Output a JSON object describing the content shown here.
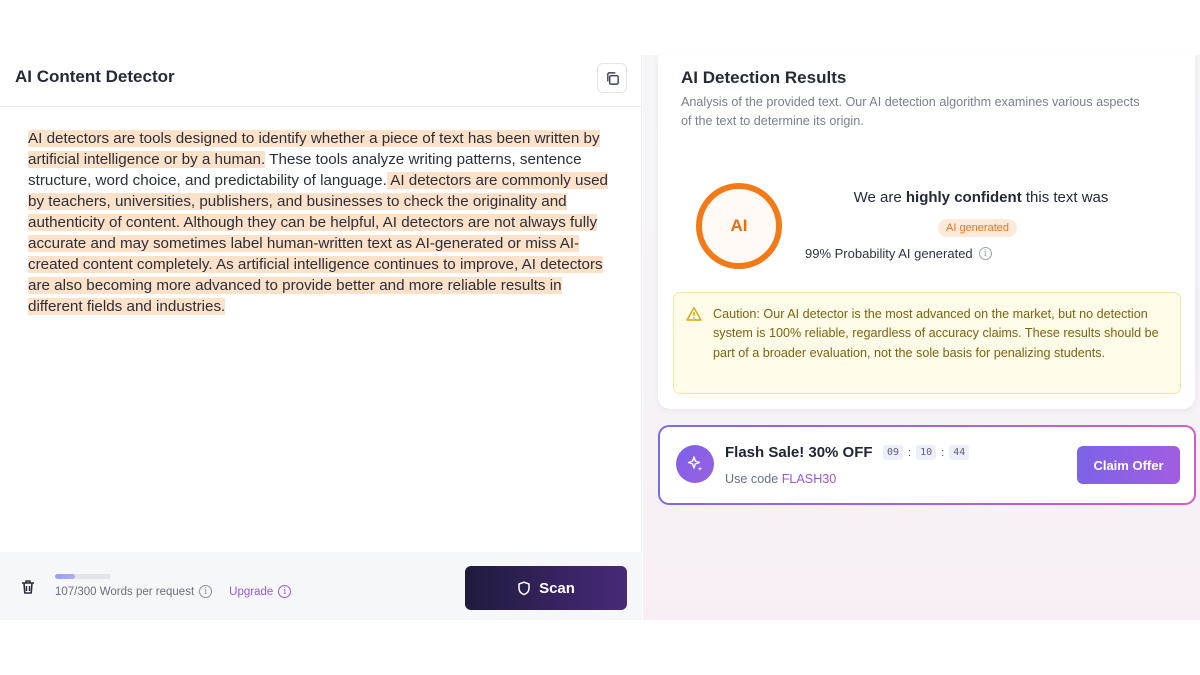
{
  "editor": {
    "title": "AI Content Detector",
    "paragraph_segments": [
      "AI detectors are tools designed to identify whether a piece of text has been written by artificial intelligence or by a human.",
      " These tools analyze writing patterns, sentence structure, word choice, and predictability of language.",
      " AI detectors are commonly used by teachers, universities, publishers, and businesses to check the originality and authenticity of content.",
      " Although they can be helpful, AI detectors are not always fully accurate and may sometimes label human-written text as AI-generated or miss AI-created content completely.",
      " As artificial intelligence continues to improve, AI detectors are also becoming more advanced to provide better and more reliable results in different fields and industries."
    ],
    "word_count_text": "107/300 Words per request",
    "word_usage_fraction": 0.357,
    "upgrade_label": "Upgrade",
    "scan_label": "Scan",
    "icons": {
      "copy": "copy-icon",
      "trash": "trash-icon",
      "shield": "shield-icon",
      "info": "info-icon"
    }
  },
  "results": {
    "title": "AI Detection Results",
    "subtitle": "Analysis of the provided text. Our AI detection algorithm examines various aspects of the text to determine its origin.",
    "ring_label": "AI",
    "confidence_prefix": "We are ",
    "confidence_strong": "highly confident",
    "confidence_suffix": " this text was",
    "verdict_badge": "AI generated",
    "probability_text": "99% Probability AI generated",
    "caution_text": "Caution: Our AI detector is the most advanced on the market, but no detection system is 100% reliable, regardless of accuracy claims. These results should be part of a broader evaluation, not the sole basis for penalizing students.",
    "colors": {
      "ring": "#f47a17",
      "badge_bg": "#fde9da",
      "caution_bg": "#fefbe8"
    }
  },
  "promo": {
    "title": "Flash Sale! 30% OFF",
    "timer": [
      "09",
      "10",
      "44"
    ],
    "code_prefix": "Use code ",
    "code": "FLASH30",
    "claim_label": "Claim Offer",
    "icon": "sparkle-icon"
  }
}
